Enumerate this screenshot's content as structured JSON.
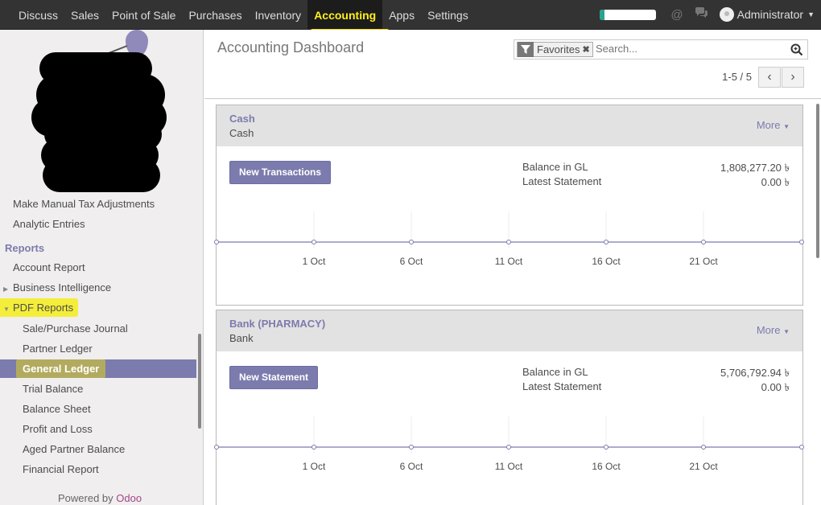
{
  "topbar": {
    "menu": [
      "Discuss",
      "Sales",
      "Point of Sale",
      "Purchases",
      "Inventory",
      "Accounting",
      "Apps",
      "Settings"
    ],
    "active": "Accounting",
    "progress": 0.08,
    "user": "Administrator",
    "icons": [
      "at-icon",
      "chat-icon"
    ]
  },
  "sidebar": {
    "items_top": [
      "Make Manual Tax Adjustments",
      "Analytic Entries"
    ],
    "section": "Reports",
    "reports": [
      "Account Report",
      "Business Intelligence",
      "PDF Reports"
    ],
    "pdf_reports": [
      "Sale/Purchase Journal",
      "Partner Ledger",
      "General Ledger",
      "Trial Balance",
      "Balance Sheet",
      "Profit and Loss",
      "Aged Partner Balance",
      "Financial Report"
    ],
    "active": "General Ledger",
    "powered_prefix": "Powered by ",
    "powered_brand": "Odoo"
  },
  "control_panel": {
    "title": "Accounting Dashboard",
    "facet": "Favorites",
    "search_placeholder": "Search...",
    "pager": "1-5 / 5"
  },
  "journals": [
    {
      "name": "Cash",
      "type": "Cash",
      "more": "More",
      "action": "New Transactions",
      "balance_label": "Balance in GL",
      "balance_value": "1,808,277.20 ৳",
      "statement_label": "Latest Statement",
      "statement_value": "0.00 ৳"
    },
    {
      "name": "Bank (PHARMACY)",
      "type": "Bank",
      "more": "More",
      "action": "New Statement",
      "balance_label": "Balance in GL",
      "balance_value": "5,706,792.94 ৳",
      "statement_label": "Latest Statement",
      "statement_value": "0.00 ৳"
    }
  ],
  "graph_ticks": [
    "1 Oct",
    "6 Oct",
    "11 Oct",
    "16 Oct",
    "21 Oct"
  ],
  "colors": {
    "brand": "#7c7bad",
    "topbar": "#333333",
    "highlight": "#f4ee3a"
  }
}
